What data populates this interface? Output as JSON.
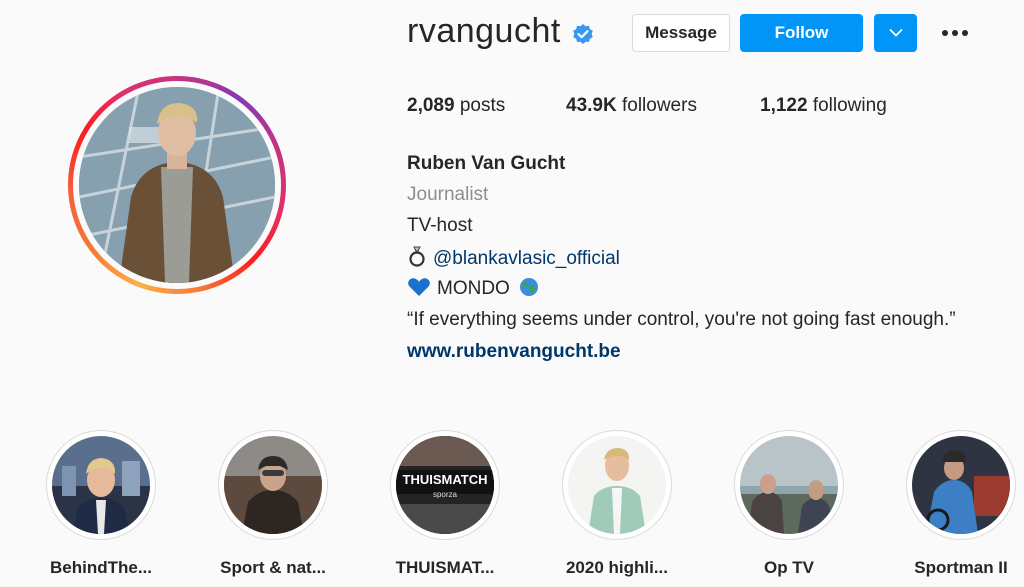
{
  "profile": {
    "username": "rvangucht",
    "buttons": {
      "message": "Message",
      "follow": "Follow"
    },
    "stats": {
      "posts_count": "2,089",
      "posts_label": "posts",
      "followers_count": "43.9K",
      "followers_label": "followers",
      "following_count": "1,122",
      "following_label": "following"
    },
    "bio": {
      "name": "Ruben Van Gucht",
      "category": "Journalist",
      "line1": "TV-host",
      "mention": "@blankavlasic_official",
      "line3_text": "MONDO",
      "quote": "“If everything seems under control, you're not going fast enough.”",
      "website": "www.rubenvangucht.be"
    }
  },
  "highlights": [
    {
      "label": "BehindThe..."
    },
    {
      "label": "Sport & nat..."
    },
    {
      "label": "THUISMAT...",
      "cover_text": "THUISMATCH",
      "cover_subtext": "sporza"
    },
    {
      "label": "2020 highli..."
    },
    {
      "label": "Op TV"
    },
    {
      "label": "Sportman II"
    }
  ],
  "colors": {
    "accent": "#0095f6",
    "link": "#00376b",
    "muted": "#8e8e8e",
    "text": "#262626",
    "verified": "#3897f0"
  }
}
